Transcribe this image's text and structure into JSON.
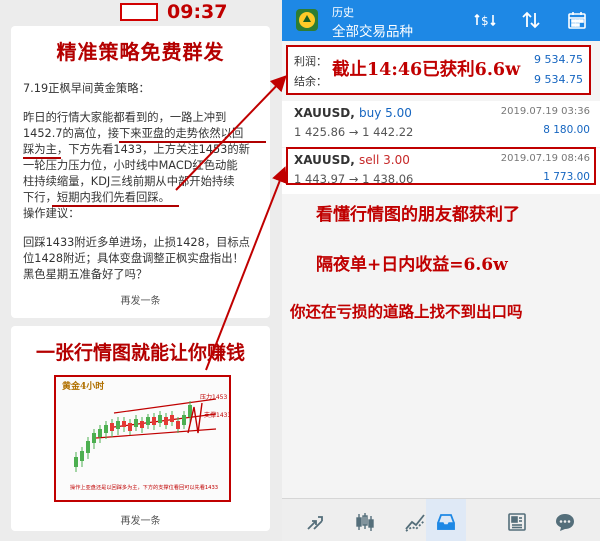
{
  "left": {
    "time": "09:37",
    "card1": {
      "title": "精准策略免费群发",
      "lines": [
        "7.19正枫早间黄金策略：",
        "昨日的行情大家能都看到的，一路上冲到",
        "1452.7的高位，接下来亚盘的走势依然以回",
        "踩为主，下方先看1433，上方关注1453的新",
        "一轮压力压力位，小时线中MACD红色动能",
        "柱持续缩量，KDJ三线前期从中部开始持续",
        "下行，短期内我们先看回踩。",
        "操作建议：",
        "回踩1433附近多单进场，止损1428，目标点",
        "位1428附近；具体变盘调整正枫实盘指出！",
        "黑色星期五准备好了吗？"
      ],
      "more": "再发一条"
    },
    "card2": {
      "title": "一张行情图就能让你赚钱",
      "more": "再发一条",
      "chart": {
        "logo": "黄金4小时",
        "label_resist": "压力1453",
        "label_support": "支撑1433",
        "caption": "操作上亚盘还是以回踩多为主，下方的支撑位看回可以先看1433"
      }
    }
  },
  "right": {
    "appbar": {
      "title_small": "历史",
      "title_main": "全部交易品种"
    },
    "summary": {
      "profit_label": "利润：",
      "balance_label": "结余：",
      "profit_value": "9 534.75",
      "balance_value": "9 534.75",
      "banner": "截止14:46已获利6.6w"
    },
    "trades": [
      {
        "symbol": "XAUUSD,",
        "side": "buy 5.00",
        "prices": "1 425.86 → 1 442.22",
        "date": "2019.07.19 03:36",
        "profit": "8 180.00"
      },
      {
        "symbol": "XAUUSD,",
        "side": "sell 3.00",
        "prices": "1 443.97 → 1 438.06",
        "date": "2019.07.19 08:46",
        "profit": "1 773.00"
      }
    ],
    "captions": [
      "看懂行情图的朋友都获利了",
      "隔夜单+日内收益=6.6w",
      "你还在亏损的道路上找不到出口吗"
    ]
  },
  "colors": {
    "accent_red": "#c00000",
    "appbar_blue": "#1e88e5",
    "value_blue": "#1565c0"
  },
  "icons": {
    "appbar": [
      "dollar-swap-icon",
      "sort-icon",
      "calendar-icon"
    ],
    "bottom_nav": [
      "trade-arrows-icon",
      "candlestick-icon",
      "line-chart-icon",
      "inbox-icon",
      "news-icon",
      "chat-icon"
    ]
  }
}
